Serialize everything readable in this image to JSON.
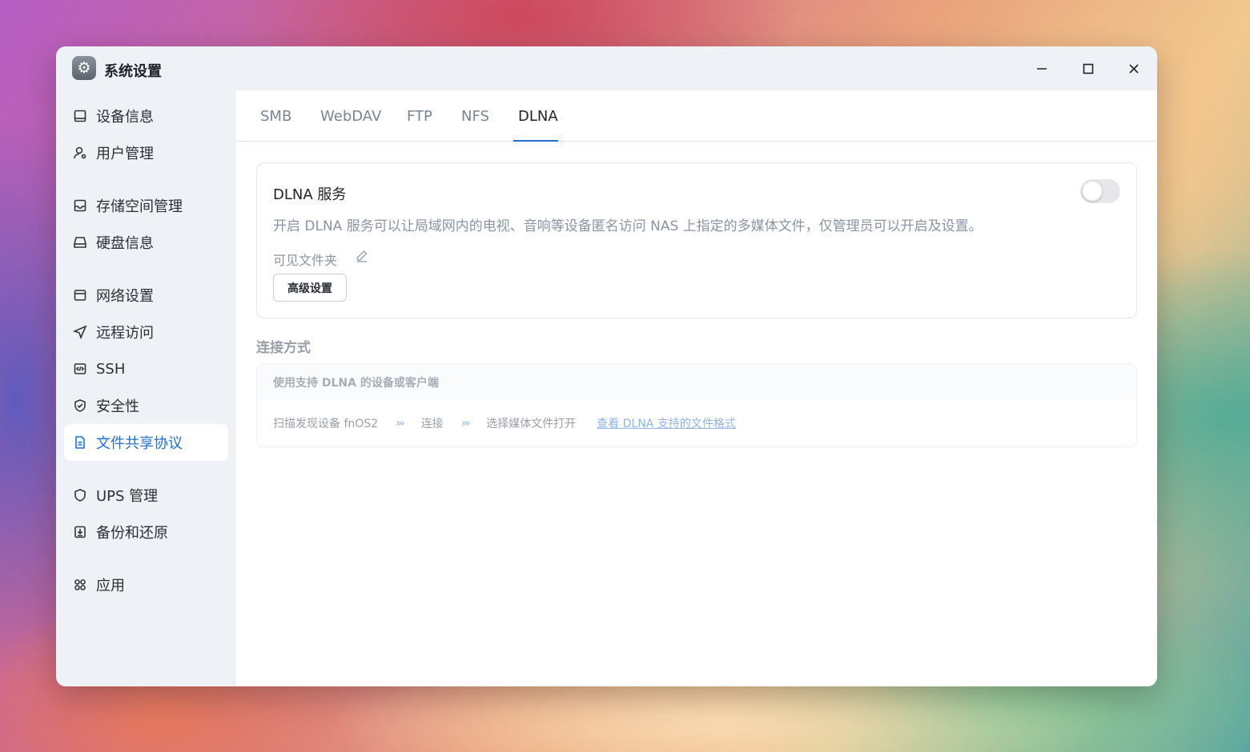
{
  "window": {
    "title": "系统设置",
    "icon": "gear-icon",
    "controls": {
      "minimize": "minimize-icon",
      "maximize": "maximize-icon",
      "close": "close-icon"
    }
  },
  "sidebar": {
    "items": [
      {
        "label": "设备信息",
        "icon": "device-icon"
      },
      {
        "label": "用户管理",
        "icon": "user-icon"
      },
      {
        "label": "存储空间管理",
        "icon": "storage-icon"
      },
      {
        "label": "硬盘信息",
        "icon": "disk-icon"
      },
      {
        "label": "网络设置",
        "icon": "network-icon"
      },
      {
        "label": "远程访问",
        "icon": "send-icon"
      },
      {
        "label": "SSH",
        "icon": "code-icon"
      },
      {
        "label": "安全性",
        "icon": "shield-check-icon"
      },
      {
        "label": "文件共享协议",
        "icon": "file-icon",
        "active": true
      },
      {
        "label": "UPS 管理",
        "icon": "shield-icon"
      },
      {
        "label": "备份和还原",
        "icon": "backup-icon"
      },
      {
        "label": "应用",
        "icon": "apps-icon"
      }
    ]
  },
  "tabs": [
    {
      "label": "SMB"
    },
    {
      "label": "WebDAV"
    },
    {
      "label": "FTP"
    },
    {
      "label": "NFS"
    },
    {
      "label": "DLNA",
      "active": true
    }
  ],
  "dlna": {
    "title": "DLNA 服务",
    "enabled": false,
    "description": "开启 DLNA 服务可以让局域网内的电视、音响等设备匿名访问 NAS 上指定的多媒体文件，仅管理员可以开启及设置。",
    "visible_folder_label": "可见文件夹",
    "advanced_button": "高级设置"
  },
  "connection": {
    "section_title": "连接方式",
    "header": "使用支持 DLNA 的设备或客户端",
    "steps": [
      "扫描发现设备 fnOS2",
      "连接",
      "选择媒体文件打开"
    ],
    "arrow": "›››",
    "link": "查看 DLNA 支持的文件格式"
  },
  "colors": {
    "accent": "#1f6fd6",
    "window_bg": "#eef2f7",
    "content_bg": "#ffffff"
  }
}
